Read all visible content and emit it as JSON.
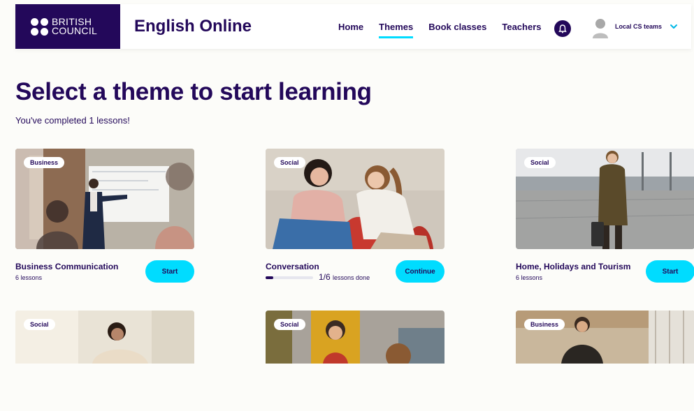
{
  "brand": {
    "logo_line1": "BRITISH",
    "logo_line2": "COUNCIL",
    "app_title": "English Online",
    "color_primary": "#23085a",
    "color_accent": "#00dcff"
  },
  "nav": {
    "items": [
      {
        "label": "Home",
        "active": false
      },
      {
        "label": "Themes",
        "active": true
      },
      {
        "label": "Book classes",
        "active": false
      },
      {
        "label": "Teachers",
        "active": false
      }
    ],
    "notification_icon": "bell-icon",
    "user_name": "Local CS teams",
    "user_menu_icon": "chevron-down-icon"
  },
  "page": {
    "title": "Select a theme to start learning",
    "subtitle": "You've completed 1 lessons!"
  },
  "themes": [
    {
      "badge": "Business",
      "title": "Business Communication",
      "lessons": "6 lessons",
      "button": "Start"
    },
    {
      "badge": "Social",
      "title": "Conversation",
      "progress_done": 1,
      "progress_total": 6,
      "progress_fraction": "1/6",
      "progress_label": "lessons done",
      "button": "Continue"
    },
    {
      "badge": "Social",
      "title": "Home, Holidays and Tourism",
      "lessons": "6 lessons",
      "button": "Start"
    },
    {
      "badge": "Social"
    },
    {
      "badge": "Social"
    },
    {
      "badge": "Business"
    }
  ]
}
